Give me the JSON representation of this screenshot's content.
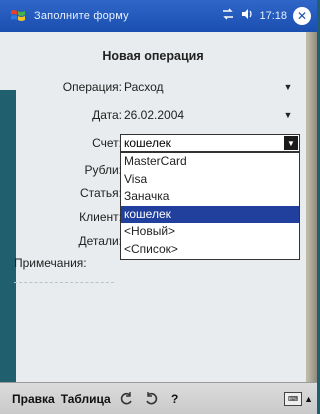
{
  "titlebar": {
    "title": "Заполните форму",
    "time": "17:18"
  },
  "form": {
    "heading": "Новая операция",
    "operation": {
      "label": "Операция:",
      "value": "Расход"
    },
    "date": {
      "label": "Дата:",
      "value": "26.02.2004"
    },
    "account": {
      "label": "Счет:",
      "value": "кошелек",
      "options": [
        "MasterCard",
        "Visa",
        "Заначка",
        "кошелек",
        "<Новый>",
        "<Список>"
      ],
      "selected_index": 3
    },
    "rubles": {
      "label": "Рубли:"
    },
    "article": {
      "label": "Статья:"
    },
    "client": {
      "label": "Клиент:"
    },
    "details": {
      "label": "Детали:"
    },
    "notes": {
      "label": "Примечания:"
    }
  },
  "cmdbar": {
    "edit_menu": "Правка",
    "table_menu": "Таблица",
    "help_glyph": "?"
  },
  "colors": {
    "titlebar": "#1a4fb0",
    "selection": "#213f9c",
    "background": "#e9ecee"
  },
  "icons": [
    "windows-start-icon",
    "connectivity-icon",
    "volume-icon",
    "close-icon",
    "undo-icon",
    "redo-icon",
    "keyboard-icon"
  ]
}
